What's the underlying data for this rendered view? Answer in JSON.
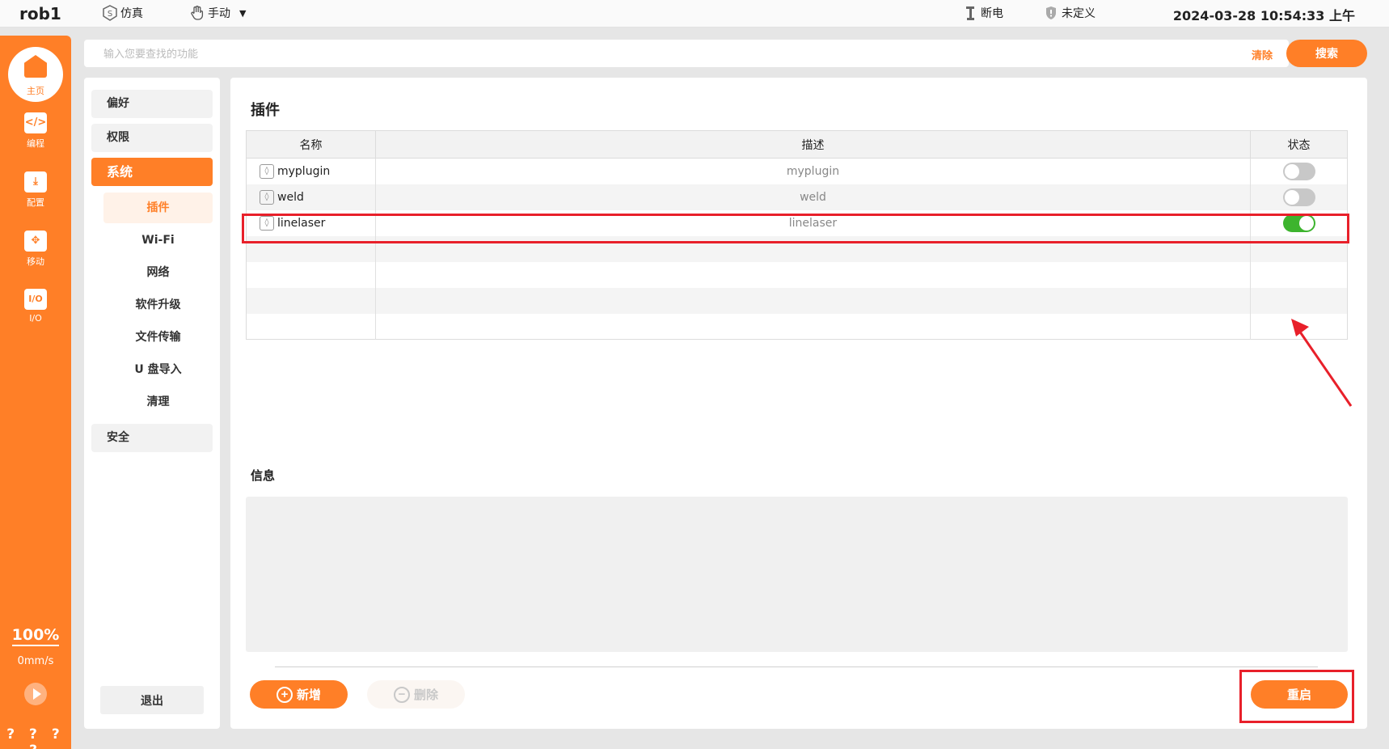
{
  "topbar": {
    "robot": "rob1",
    "mode": "仿真",
    "mode_icon": "s-badge-icon",
    "operation": "手动",
    "power": "断电",
    "safety": "未定义",
    "datetime": "2024-03-28 10:54:33 上午"
  },
  "rail": {
    "home": "主页",
    "items": [
      {
        "label": "编程",
        "icon": "code-icon"
      },
      {
        "label": "配置",
        "icon": "download-icon"
      },
      {
        "label": "移动",
        "icon": "move-icon"
      },
      {
        "label": "I/O",
        "icon": "io-icon"
      }
    ],
    "speed_percent": "100%",
    "speed_value": "0mm/s",
    "status": "? ? ? ?"
  },
  "search": {
    "placeholder": "输入您要查找的功能",
    "value": "",
    "clear": "清除",
    "button": "搜索"
  },
  "menu": {
    "categories": [
      "偏好",
      "权限",
      "系统",
      "安全"
    ],
    "active_category": "系统",
    "sub_items": [
      "插件",
      "Wi-Fi",
      "网络",
      "软件升级",
      "文件传输",
      "U 盘导入",
      "清理"
    ],
    "active_sub": "插件",
    "logout": "退出"
  },
  "main": {
    "title": "插件",
    "columns": [
      "名称",
      "描述",
      "状态"
    ],
    "rows": [
      {
        "name": "myplugin",
        "desc": "myplugin",
        "enabled": false
      },
      {
        "name": "weld",
        "desc": "weld",
        "enabled": false
      },
      {
        "name": "linelaser",
        "desc": "linelaser",
        "enabled": true
      }
    ],
    "info_title": "信息",
    "info_text": "",
    "add": "新增",
    "delete": "删除",
    "restart": "重启"
  },
  "colors": {
    "accent": "#ff7f27",
    "toggle_on": "#3db42e",
    "annotation": "#e8202a"
  }
}
